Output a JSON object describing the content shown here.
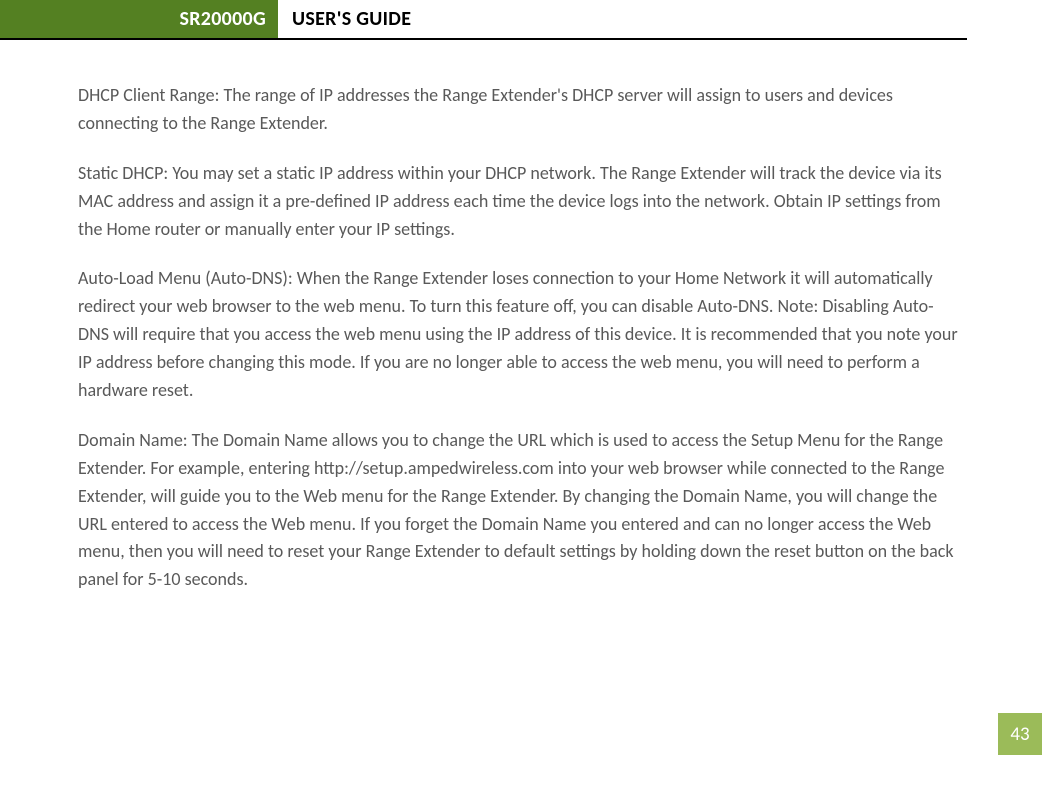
{
  "header": {
    "model": "SR20000G",
    "title": "USER'S GUIDE"
  },
  "paragraphs": {
    "p1": "DHCP Client Range: The range of IP addresses the Range Extender's DHCP server will assign to users and devices connecting to the Range Extender.",
    "p2": "Static DHCP: You may set a static IP address within your DHCP network. The Range Extender will track the device via its MAC address and assign it a pre-defined IP address each time the device logs into the network. Obtain IP settings from the Home router or manually enter your IP settings.",
    "p3": "Auto-Load Menu (Auto-DNS): When the Range Extender loses connection to your Home Network it will automatically redirect your web browser to the web menu. To turn this feature off, you can disable Auto-DNS. Note: Disabling Auto-DNS will require that you access the web menu using the IP address of this device. It is recommended that you note your IP address before changing this mode. If you are no longer able to access the web menu, you will need to perform a hardware reset.",
    "p4": "Domain Name: The Domain Name allows you to change the URL which is used to access the Setup Menu for the Range Extender. For example, entering http://setup.ampedwireless.com into your web browser while connected to the Range Extender, will guide you to the Web menu for the Range Extender. By changing the Domain Name, you will change the URL entered to access the Web menu. If you forget the Domain Name you entered and can no longer access the Web menu, then you will need to reset your Range Extender to default settings by holding down the reset button on the back panel for 5-10 seconds."
  },
  "page_number": "43"
}
